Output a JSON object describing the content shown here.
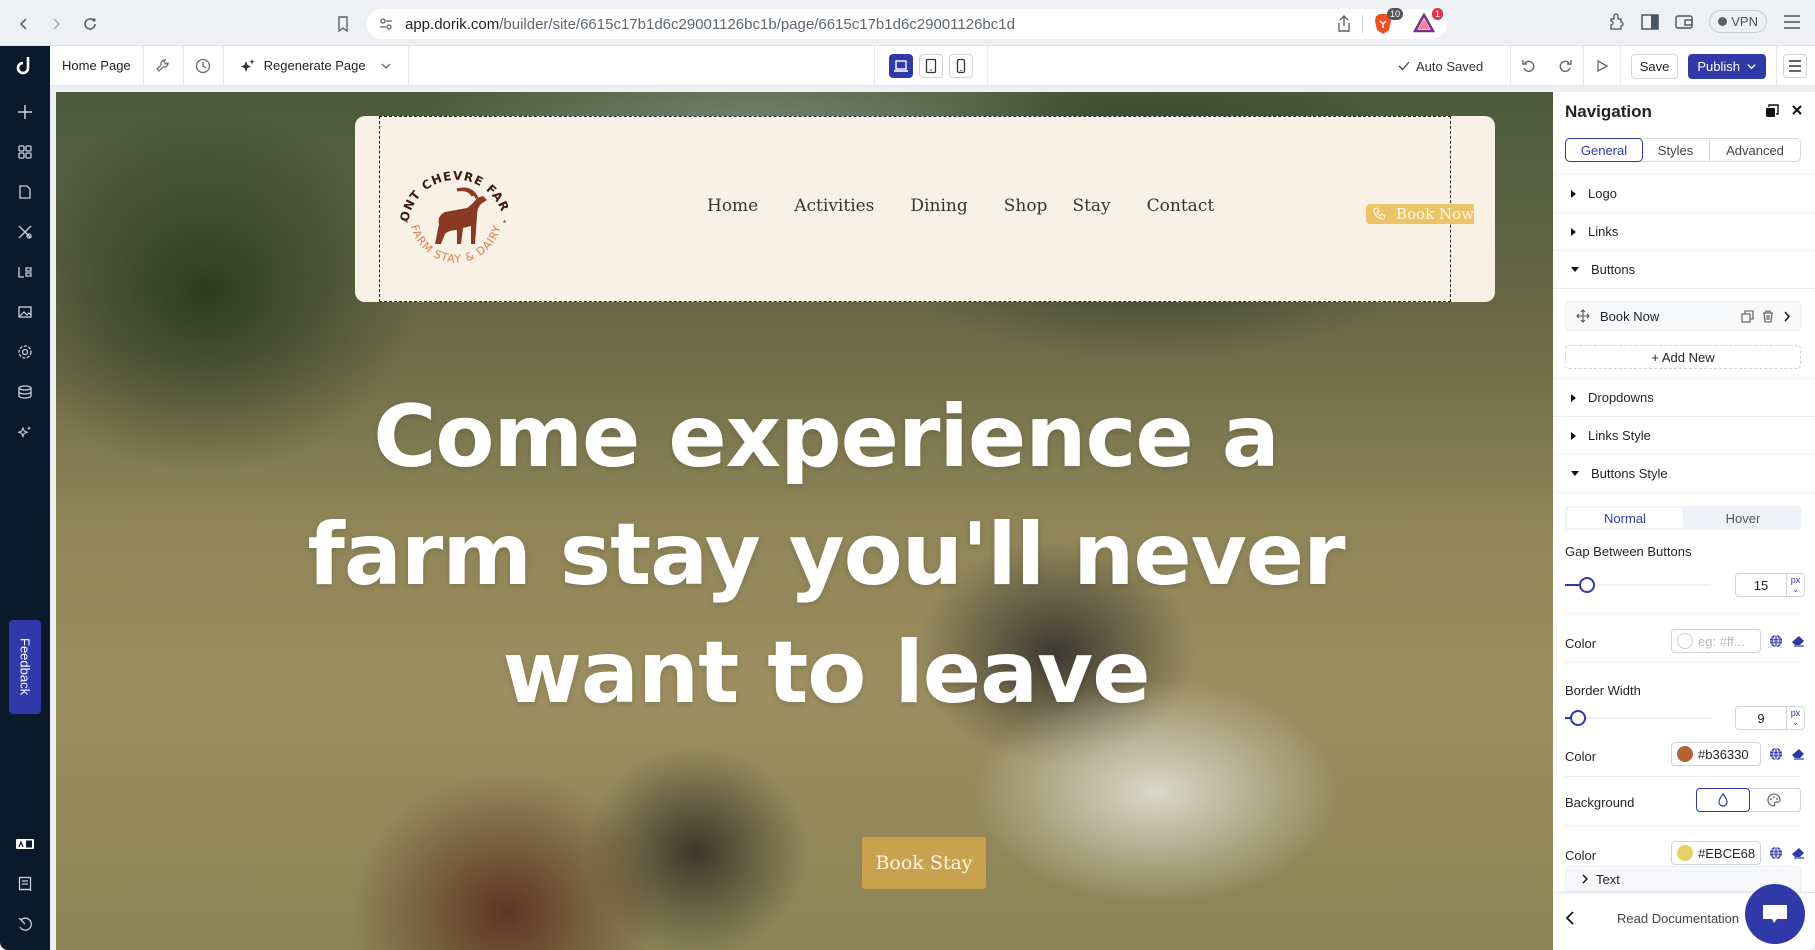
{
  "browser": {
    "url_host": "app.dorik.com",
    "url_path": "/builder/site/6615c17b1d6c29001126bc1b/page/6615c17b1d6c29001126bc1d",
    "brave_badge": "10",
    "rewards_badge": "1",
    "vpn_label": "VPN"
  },
  "topbar": {
    "page_name": "Home Page",
    "regenerate_label": "Regenerate Page",
    "auto_saved_label": "Auto Saved",
    "save_label": "Save",
    "publish_label": "Publish",
    "device_modes": [
      "desktop",
      "tablet",
      "mobile"
    ],
    "active_device": "desktop"
  },
  "sidebar": {
    "icons": [
      "add-icon",
      "blocks-icon",
      "pages-icon",
      "design-icon",
      "layout-icon",
      "media-icon",
      "settings-icon",
      "cms-icon",
      "ai-icon"
    ],
    "bottom_icons": [
      "ai-badge-icon",
      "docs-icon",
      "history-icon"
    ],
    "feedback_label": "Feedback"
  },
  "site": {
    "logo": {
      "top_text": "MONT CHEVRE FARMS",
      "bottom_text": "FARM STAY & DAIRY"
    },
    "nav_links": [
      "Home",
      "Activities",
      "Dining",
      "Shop",
      "Stay",
      "Contact"
    ],
    "book_now_label": "Book Now",
    "hero_title": "Come experience a farm stay you'll never want to leave",
    "book_stay_label": "Book Stay"
  },
  "panel": {
    "title": "Navigation",
    "tabs": [
      "General",
      "Styles",
      "Advanced"
    ],
    "active_tab": "General",
    "sections": {
      "logo": "Logo",
      "links": "Links",
      "buttons": "Buttons",
      "dropdowns": "Dropdowns",
      "links_style": "Links Style",
      "buttons_style": "Buttons Style"
    },
    "buttons_list": [
      {
        "label": "Book Now"
      }
    ],
    "add_new_label": "+ Add New",
    "state_tabs": [
      "Normal",
      "Hover"
    ],
    "active_state": "Normal",
    "gap_between_buttons": {
      "label": "Gap Between Buttons",
      "value": "15",
      "unit": "px",
      "slider_fraction": 0.15
    },
    "color1": {
      "label": "Color",
      "placeholder": "eg: #ff..."
    },
    "border_width": {
      "label": "Border Width",
      "value": "9",
      "unit": "px",
      "slider_fraction": 0.09
    },
    "border_color": {
      "label": "Color",
      "value": "#b36330"
    },
    "background": {
      "label": "Background",
      "modes": [
        "solid",
        "gradient"
      ],
      "active": "solid"
    },
    "bg_color": {
      "label": "Color",
      "value": "#EBCE68"
    },
    "text_section": "Text",
    "read_docs_label": "Read Documentation"
  },
  "colors": {
    "accent": "#2f3aa8",
    "sidebar_bg": "#0a1a2b",
    "header_bg": "#f9f1e5",
    "book_now_bg": "#ebc468",
    "book_stay_bg": "#c9a24f",
    "logo_dark": "#3a1a12",
    "logo_accent": "#e07a4f"
  }
}
